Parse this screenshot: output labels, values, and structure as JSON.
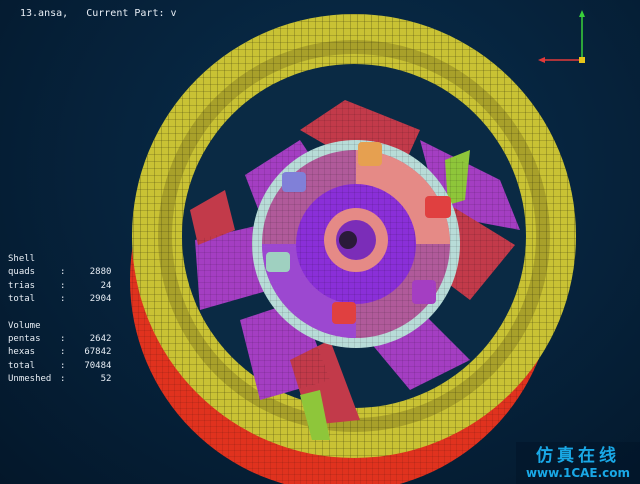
{
  "header": {
    "title": "13.ansa,   Current Part: v"
  },
  "stats": {
    "shell_heading": "Shell",
    "shell_rows": [
      {
        "label": "quads",
        "sep": ":",
        "value": "2880"
      },
      {
        "label": "trias",
        "sep": ":",
        "value": "24"
      },
      {
        "label": "total",
        "sep": ":",
        "value": "2904"
      }
    ],
    "volume_heading": "Volume",
    "volume_rows": [
      {
        "label": "pentas",
        "sep": ":",
        "value": "2642"
      },
      {
        "label": "hexas",
        "sep": ":",
        "value": "67842"
      },
      {
        "label": "total",
        "sep": ":",
        "value": "70484"
      },
      {
        "label": "Unmeshed",
        "sep": ":",
        "value": "52"
      }
    ]
  },
  "axis": {
    "x_color": "#e23a3a",
    "y_color": "#3ad13a",
    "z_color": "#e6c51a"
  },
  "model_colors": {
    "rim_outer": "#e0321e",
    "rim_main": "#c9c234",
    "hub_ring": "#b8dcd8",
    "spoke_purple": "#a43ec2",
    "spoke_red": "#c23a4a",
    "hub_salmon": "#e58a86",
    "hub_violet": "#8a2fd8",
    "green_band": "#8ec63a"
  },
  "watermark": {
    "brand_top": "仿真在线",
    "brand_bottom": "www.1CAE.com"
  }
}
